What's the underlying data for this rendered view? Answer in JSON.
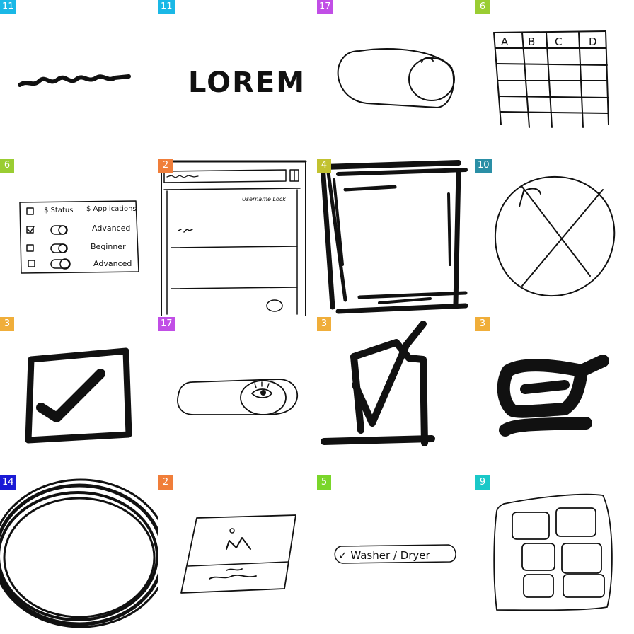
{
  "cells": [
    {
      "label": "11",
      "color": "#1ab8e6"
    },
    {
      "label": "11",
      "color": "#1ab8e6"
    },
    {
      "label": "17",
      "color": "#c14ee6"
    },
    {
      "label": "6",
      "color": "#9acd32"
    },
    {
      "label": "6",
      "color": "#9acd32"
    },
    {
      "label": "2",
      "color": "#f07e3a"
    },
    {
      "label": "4",
      "color": "#c2c230"
    },
    {
      "label": "10",
      "color": "#2a8fa6"
    },
    {
      "label": "3",
      "color": "#f0ae3a"
    },
    {
      "label": "17",
      "color": "#c14ee6"
    },
    {
      "label": "3",
      "color": "#f0ae3a"
    },
    {
      "label": "3",
      "color": "#f0ae3a"
    },
    {
      "label": "14",
      "color": "#1a1ad6"
    },
    {
      "label": "2",
      "color": "#f07e3a"
    },
    {
      "label": "5",
      "color": "#7ad62a"
    },
    {
      "label": "9",
      "color": "#1ac8c8"
    }
  ],
  "sketch_text": {
    "lorem": "LOREM",
    "table_headers": [
      "A",
      "B",
      "C",
      "D"
    ],
    "list_headers": [
      "$ Status",
      "$ Applications"
    ],
    "list_rows": [
      "Advanced",
      "Beginner",
      "Advanced"
    ],
    "browser_user": "Username Lock",
    "chip_label": "✓ Washer / Dryer"
  }
}
